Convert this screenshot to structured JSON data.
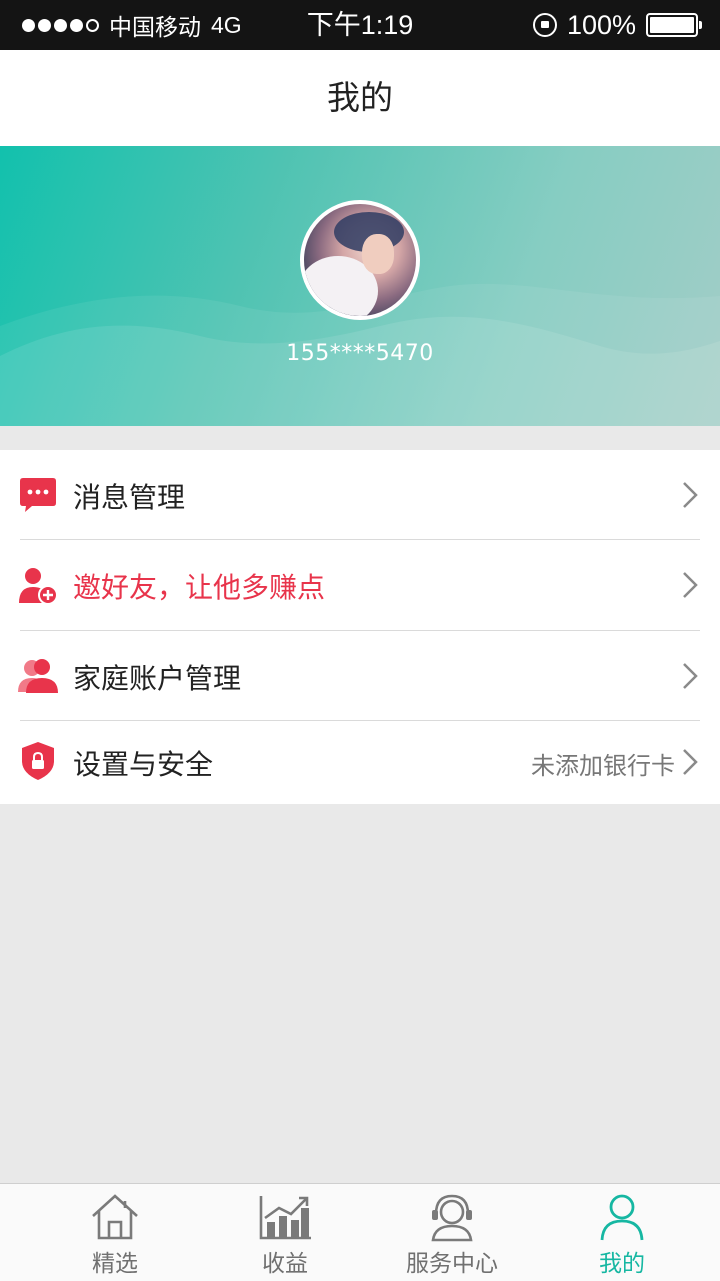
{
  "status_bar": {
    "carrier": "中国移动",
    "network": "4G",
    "time": "下午1:19",
    "battery": "100%"
  },
  "nav": {
    "title": "我的"
  },
  "profile": {
    "phone": "155****5470"
  },
  "menu": [
    {
      "label": "消息管理",
      "icon": "message-icon",
      "color": "#e8344b"
    },
    {
      "label": "邀好友，让他多赚点",
      "icon": "add-friend-icon",
      "color": "#e8344b"
    },
    {
      "label": "家庭账户管理",
      "icon": "family-users-icon",
      "color": "#e8344b"
    },
    {
      "label": "设置与安全",
      "icon": "shield-lock-icon",
      "color": "#e8344b",
      "sub": "未添加银行卡"
    }
  ],
  "tabs": [
    {
      "label": "精选",
      "icon": "home-icon"
    },
    {
      "label": "收益",
      "icon": "chart-icon"
    },
    {
      "label": "服务中心",
      "icon": "headset-icon"
    },
    {
      "label": "我的",
      "icon": "user-icon",
      "active": true
    }
  ],
  "colors": {
    "accent": "#16b7a2",
    "highlight": "#e8344b"
  }
}
